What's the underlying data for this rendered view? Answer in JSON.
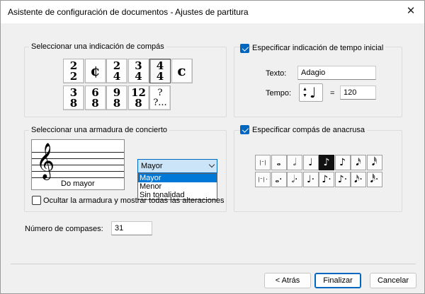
{
  "window": {
    "title": "Asistente de configuración de documentos - Ajustes de partitura",
    "close_glyph": "✕"
  },
  "time_signature": {
    "group_label": "Seleccionar una indicación de compás",
    "row1": [
      {
        "type": "fraction",
        "top": "2",
        "bottom": "2"
      },
      {
        "type": "symbol",
        "glyph": "¢"
      },
      {
        "type": "fraction",
        "top": "2",
        "bottom": "4"
      },
      {
        "type": "fraction",
        "top": "3",
        "bottom": "4"
      },
      {
        "type": "fraction",
        "top": "4",
        "bottom": "4",
        "selected": true
      },
      {
        "type": "symbol",
        "glyph": "c"
      }
    ],
    "row2": [
      {
        "type": "fraction",
        "top": "3",
        "bottom": "8"
      },
      {
        "type": "fraction",
        "top": "6",
        "bottom": "8"
      },
      {
        "type": "fraction",
        "top": "9",
        "bottom": "8"
      },
      {
        "type": "fraction",
        "top": "12",
        "bottom": "8"
      },
      {
        "type": "other",
        "top": "?",
        "bottom": "?..."
      }
    ]
  },
  "tempo": {
    "checkbox_label": "Especificar indicación de tempo inicial",
    "checked": true,
    "texto_label": "Texto:",
    "texto_value": "Adagio",
    "tempo_label": "Tempo:",
    "equals": "=",
    "bpm_value": "120",
    "note_glyph": "♩"
  },
  "key_signature": {
    "group_label": "Seleccionar una armadura de concierto",
    "clef_glyph": "𝄞",
    "staff_key_label": "Do mayor",
    "mode_selected": "Mayor",
    "mode_options": [
      "Mayor",
      "Menor",
      "Sin tonalidad"
    ],
    "hide_checkbox_label": "Ocultar la armadura y mostrar todas las alteraciones",
    "hide_checked": false
  },
  "pickup": {
    "checkbox_label": "Especificar compás de anacrusa",
    "checked": true,
    "row1": [
      "|𝄻|",
      "𝅝",
      "𝅗𝅥",
      "♩",
      "♪",
      "♪",
      "𝅘𝅥𝅯",
      "𝅘𝅥𝅰"
    ],
    "row2": [
      "|𝄻|·",
      "𝅝·",
      "𝅗𝅥·",
      "♩·",
      "♪·",
      "♪·",
      "𝅘𝅥𝅯·",
      "𝅘𝅥𝅰·"
    ],
    "selected_index": 4
  },
  "measures": {
    "label": "Número de compases:",
    "value": "31"
  },
  "buttons": {
    "back": "< Atrás",
    "finish": "Finalizar",
    "cancel": "Cancelar"
  }
}
